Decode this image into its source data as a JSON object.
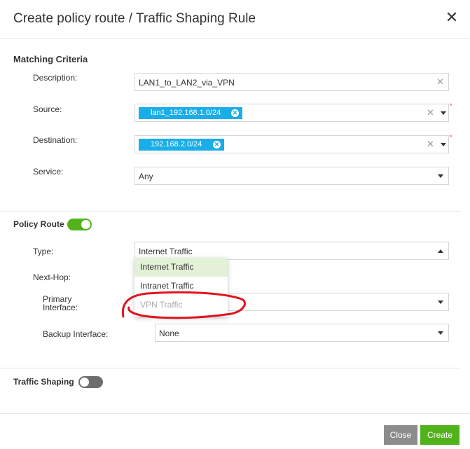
{
  "dialog": {
    "title": "Create policy route / Traffic Shaping Rule"
  },
  "matching": {
    "heading": "Matching Criteria",
    "description_label": "Description:",
    "description_value": "LAN1_to_LAN2_via_VPN",
    "source_label": "Source:",
    "source_chip": "lan1_192.168.1.0/24",
    "destination_label": "Destination:",
    "destination_chip": "192.168.2.0/24",
    "service_label": "Service:",
    "service_value": "Any",
    "required_mark": "*"
  },
  "policy_route": {
    "heading": "Policy Route",
    "enabled": true,
    "type_label": "Type:",
    "type_value": "Internet Traffic",
    "type_options": [
      "Internet Traffic",
      "Intranet Traffic",
      "VPN Traffic"
    ],
    "next_hop_label": "Next-Hop:",
    "primary_label_line1": "Primary",
    "primary_label_line2": "Interface:",
    "backup_label": "Backup Interface:",
    "backup_value": "None"
  },
  "traffic_shaping": {
    "heading": "Traffic Shaping",
    "enabled": false
  },
  "footer": {
    "close_label": "Close",
    "create_label": "Create"
  },
  "colors": {
    "accent_green": "#52b21c",
    "chip_blue": "#1aaee8",
    "annotation_red": "#e0141e",
    "close_gray": "#8c8c8c"
  },
  "icons": {
    "clear": "x-icon",
    "close": "close-icon",
    "dropdown": "chevron-down-icon"
  }
}
